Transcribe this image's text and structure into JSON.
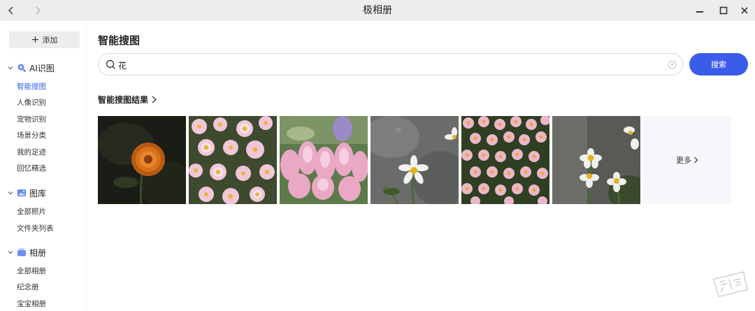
{
  "window": {
    "title": "极相册",
    "nav": {
      "back": "chevron-left-icon",
      "forward": "chevron-right-icon"
    },
    "controls": [
      "minimize-icon",
      "maximize-icon",
      "close-icon"
    ]
  },
  "sidebar": {
    "add_label": "添加",
    "groups": [
      {
        "label": "AI识图",
        "icon": "ai-search-icon",
        "items": [
          {
            "label": "智能搜图",
            "active": true
          },
          {
            "label": "人像识别",
            "active": false
          },
          {
            "label": "宠物识别",
            "active": false
          },
          {
            "label": "场景分类",
            "active": false
          },
          {
            "label": "我的足迹",
            "active": false
          },
          {
            "label": "回忆精选",
            "active": false
          }
        ]
      },
      {
        "label": "图库",
        "icon": "gallery-icon",
        "items": [
          {
            "label": "全部照片",
            "active": false
          },
          {
            "label": "文件夹列表",
            "active": false
          }
        ]
      },
      {
        "label": "相册",
        "icon": "album-icon",
        "items": [
          {
            "label": "全部相册",
            "active": false
          },
          {
            "label": "纪念册",
            "active": false
          },
          {
            "label": "宝宝相册",
            "active": false
          }
        ]
      }
    ]
  },
  "main": {
    "title": "智能搜图",
    "search": {
      "value": "花",
      "placeholder": ""
    },
    "search_button": "搜索",
    "results_title": "智能搜图结果",
    "more_label": "更多",
    "photos": [
      "orange-flower-photo",
      "pink-daisies-photo",
      "pink-snapdragons-photo",
      "white-daisy-photo",
      "pink-daisy-field-photo",
      "white-flowers-photo"
    ]
  },
  "colors": {
    "accent": "#3a5ce9",
    "titlebar": "#ededed",
    "more_tile": "#f6f7fb"
  },
  "watermark": "值得买"
}
